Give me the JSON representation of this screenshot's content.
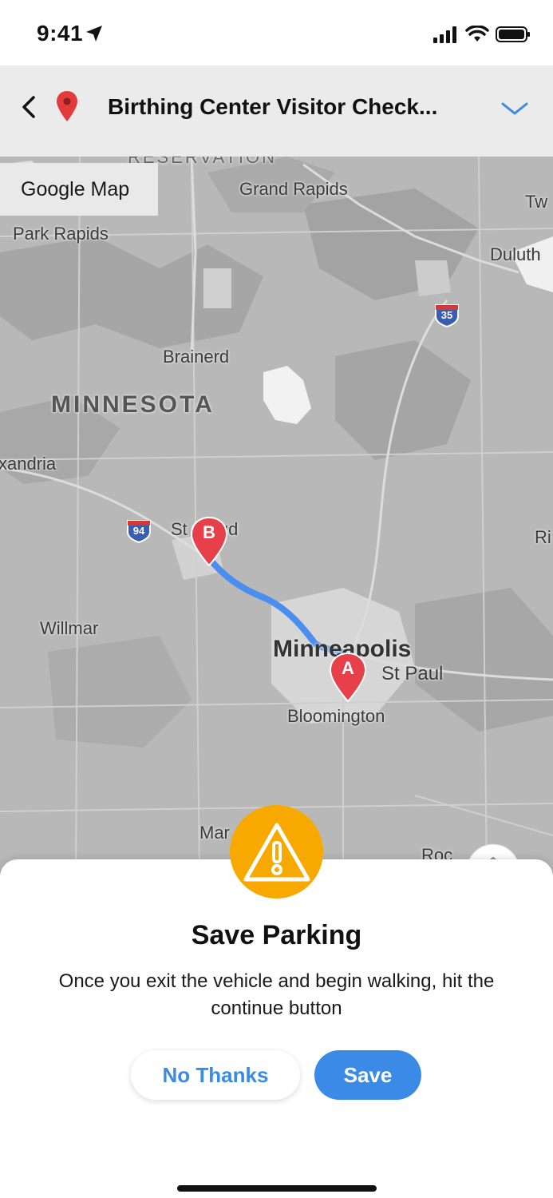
{
  "status_bar": {
    "time": "9:41"
  },
  "header": {
    "title": "Birthing Center Visitor Check...",
    "icons": [
      "back-chevron-icon",
      "map-pin-icon",
      "chevron-down-icon"
    ]
  },
  "map": {
    "source_label": "Google Map",
    "labels": {
      "reservation": "RESERVATION",
      "grand_rapids": "Grand Rapids",
      "two_harbors": "Tw",
      "park_rapids": "Park Rapids",
      "duluth": "Duluth",
      "brainerd": "Brainerd",
      "minnesota": "MINNESOTA",
      "alexandria": "xandria",
      "st_cloud": "St Cloud",
      "willmar": "Willmar",
      "minneapolis": "Minneapolis",
      "st_paul": "St Paul",
      "bloomington": "Bloomington",
      "river_falls": "Ri",
      "mankato": "Mar",
      "rochester": "Roc"
    },
    "shields": {
      "i35": "35",
      "i94": "94"
    },
    "markers": {
      "start": "A",
      "end": "B"
    },
    "colors": {
      "route": "#4a8ef0",
      "marker": "#e8404b"
    }
  },
  "dialog": {
    "icon": "warning-icon",
    "title": "Save Parking",
    "message": "Once you exit the vehicle and begin walking, hit the continue button",
    "no_thanks_label": "No Thanks",
    "save_label": "Save",
    "colors": {
      "accent": "#3a8ae6",
      "warning": "#f7a900"
    }
  }
}
